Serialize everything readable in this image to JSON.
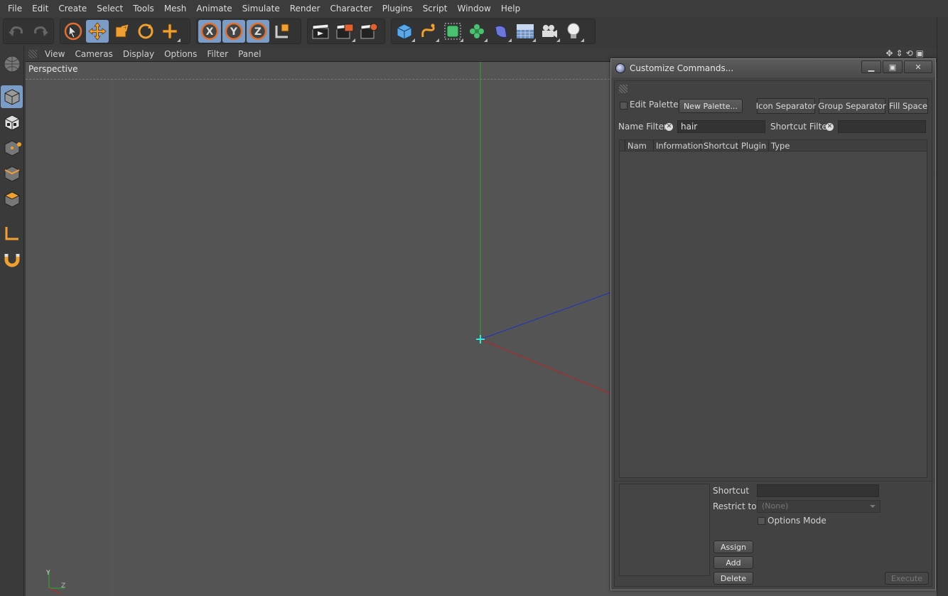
{
  "menubar": {
    "items": [
      "File",
      "Edit",
      "Create",
      "Select",
      "Tools",
      "Mesh",
      "Animate",
      "Simulate",
      "Render",
      "Character",
      "Plugins",
      "Script",
      "Window",
      "Help"
    ]
  },
  "viewport": {
    "menu": [
      "View",
      "Cameras",
      "Display",
      "Options",
      "Filter",
      "Panel"
    ],
    "label": "Perspective",
    "axis_y": "Y",
    "axis_z": "Z"
  },
  "dialog": {
    "title": "Customize Commands...",
    "edit_palettes": "Edit Palettes",
    "new_palette": "New Palette...",
    "icon_separator": "Icon Separator",
    "group_separator": "Group Separator",
    "fill_space": "Fill Space",
    "name_filter_label": "Name Filter",
    "name_filter_value": "hair",
    "shortcut_filter_label": "Shortcut Filter",
    "shortcut_filter_value": "",
    "columns": [
      "Nam",
      "Information",
      "Shortcut",
      "Plugin",
      "Type"
    ],
    "shortcut_label": "Shortcut",
    "restrict_to_label": "Restrict to",
    "restrict_to_value": "(None)",
    "options_mode": "Options Mode",
    "assign": "Assign",
    "add": "Add",
    "delete": "Delete",
    "execute": "Execute"
  },
  "colors": {
    "accent_active": "#7a9cc7",
    "orange_icon": "#f0a030",
    "axis_green": "#2aaa2a",
    "axis_blue": "#2233bb",
    "axis_red": "#bb2222"
  }
}
